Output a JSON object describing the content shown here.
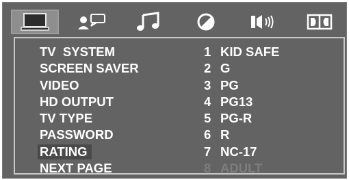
{
  "tabs": [
    {
      "icon": "tv-monitor-icon",
      "selected": true
    },
    {
      "icon": "language-speech-icon",
      "selected": false
    },
    {
      "icon": "music-note-icon",
      "selected": false
    },
    {
      "icon": "video-contrast-icon",
      "selected": false
    },
    {
      "icon": "speaker-icon",
      "selected": false
    },
    {
      "icon": "dolby-icon",
      "selected": false
    }
  ],
  "menu": [
    {
      "label": "TV  SYSTEM"
    },
    {
      "label": "SCREEN SAVER"
    },
    {
      "label": "VIDEO"
    },
    {
      "label": "HD OUTPUT"
    },
    {
      "label": "TV TYPE"
    },
    {
      "label": "PASSWORD"
    },
    {
      "label": "RATING",
      "highlighted": true
    },
    {
      "label": "NEXT PAGE"
    }
  ],
  "options": [
    {
      "num": "1",
      "label": "KID SAFE"
    },
    {
      "num": "2",
      "label": "G"
    },
    {
      "num": "3",
      "label": "PG"
    },
    {
      "num": "4",
      "label": "PG13"
    },
    {
      "num": "5",
      "label": "PG-R"
    },
    {
      "num": "6",
      "label": "R"
    },
    {
      "num": "7",
      "label": "NC-17"
    },
    {
      "num": "8",
      "label": "ADULT",
      "disabled": true
    }
  ],
  "colors": {
    "background": "#636363",
    "text": "#ffffff",
    "disabled": "#7d7d7d",
    "highlight": "#4a4a4a"
  }
}
